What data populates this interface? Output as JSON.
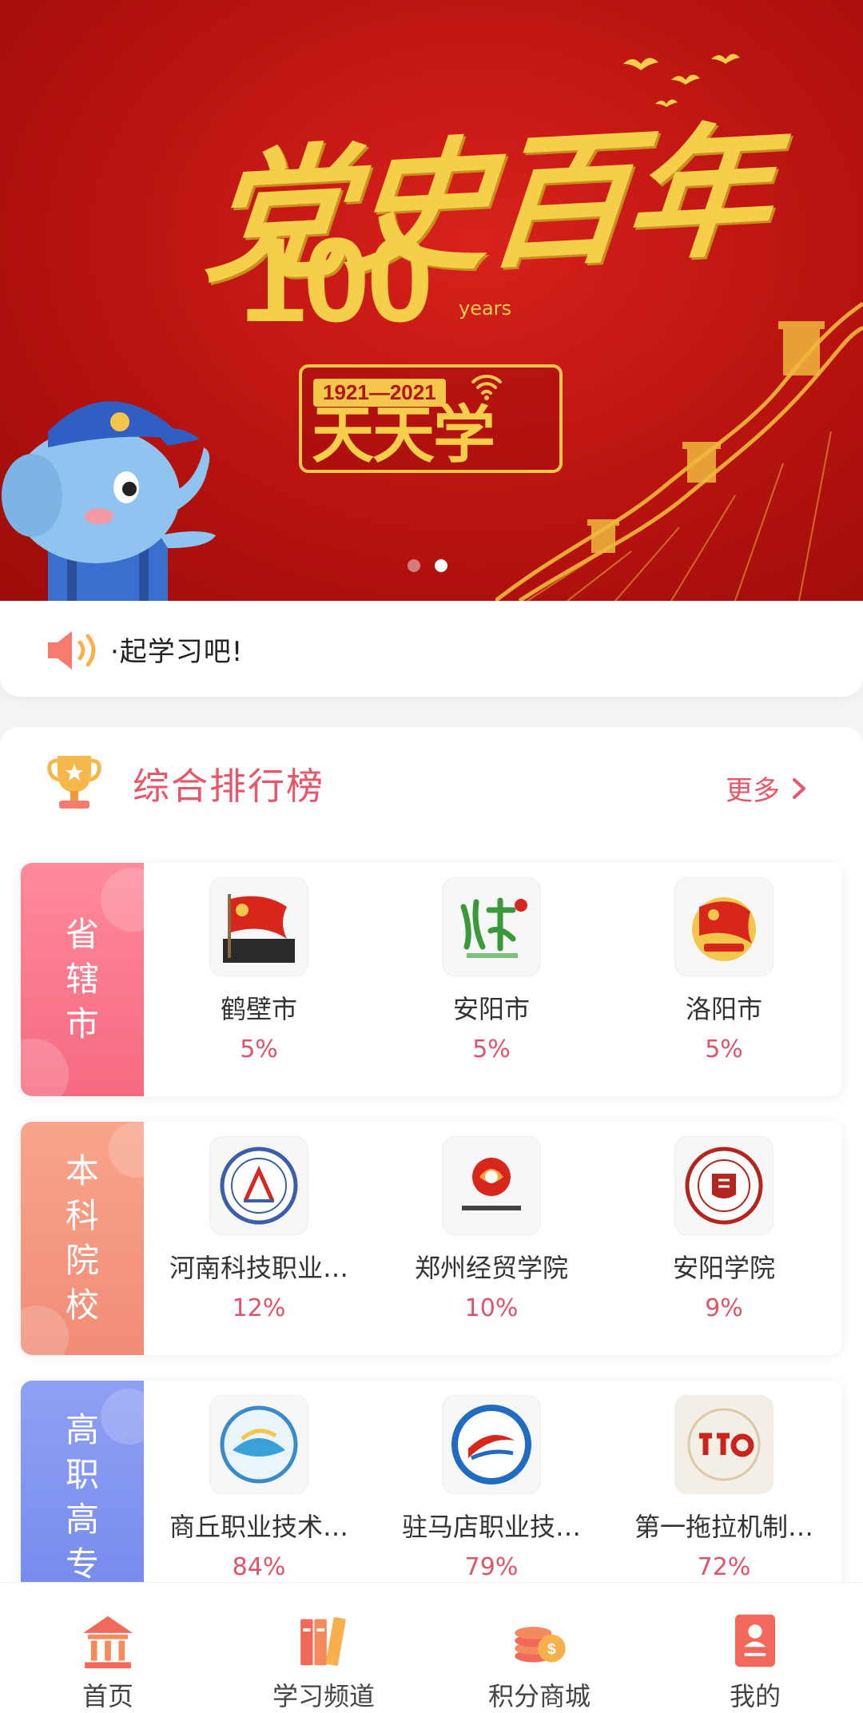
{
  "banner": {
    "title": "党史百年",
    "number": "100",
    "years_label": "years",
    "badge_years": "1921—2021",
    "badge_text": "天天学",
    "carousel": {
      "total": 2,
      "active": 2
    }
  },
  "notice": {
    "text": "·起学习吧!"
  },
  "ranking": {
    "title": "综合排行榜",
    "more_label": "更多",
    "rows": [
      {
        "category": [
          "省",
          "辖",
          "市"
        ],
        "items": [
          {
            "name": "鹤壁市",
            "percent": "5%"
          },
          {
            "name": "安阳市",
            "percent": "5%"
          },
          {
            "name": "洛阳市",
            "percent": "5%"
          }
        ]
      },
      {
        "category": [
          "本",
          "科",
          "院",
          "校"
        ],
        "items": [
          {
            "name": "河南科技职业…",
            "percent": "12%"
          },
          {
            "name": "郑州经贸学院",
            "percent": "10%"
          },
          {
            "name": "安阳学院",
            "percent": "9%"
          }
        ]
      },
      {
        "category": [
          "高",
          "职",
          "高",
          "专"
        ],
        "items": [
          {
            "name": "商丘职业技术…",
            "percent": "84%"
          },
          {
            "name": "驻马店职业技…",
            "percent": "79%"
          },
          {
            "name": "第一拖拉机制…",
            "percent": "72%"
          }
        ]
      }
    ]
  },
  "tabbar": {
    "tabs": [
      {
        "label": "首页",
        "icon": "home-icon"
      },
      {
        "label": "学习频道",
        "icon": "books-icon"
      },
      {
        "label": "积分商城",
        "icon": "coins-icon"
      },
      {
        "label": "我的",
        "icon": "profile-icon"
      }
    ]
  },
  "colors": {
    "banner_red": "#b8130f",
    "gold": "#f6cf4a",
    "accent_pink": "#e8566a",
    "label_pink": "#f66a80",
    "label_orange": "#f18c77",
    "label_blue": "#7489ec"
  }
}
